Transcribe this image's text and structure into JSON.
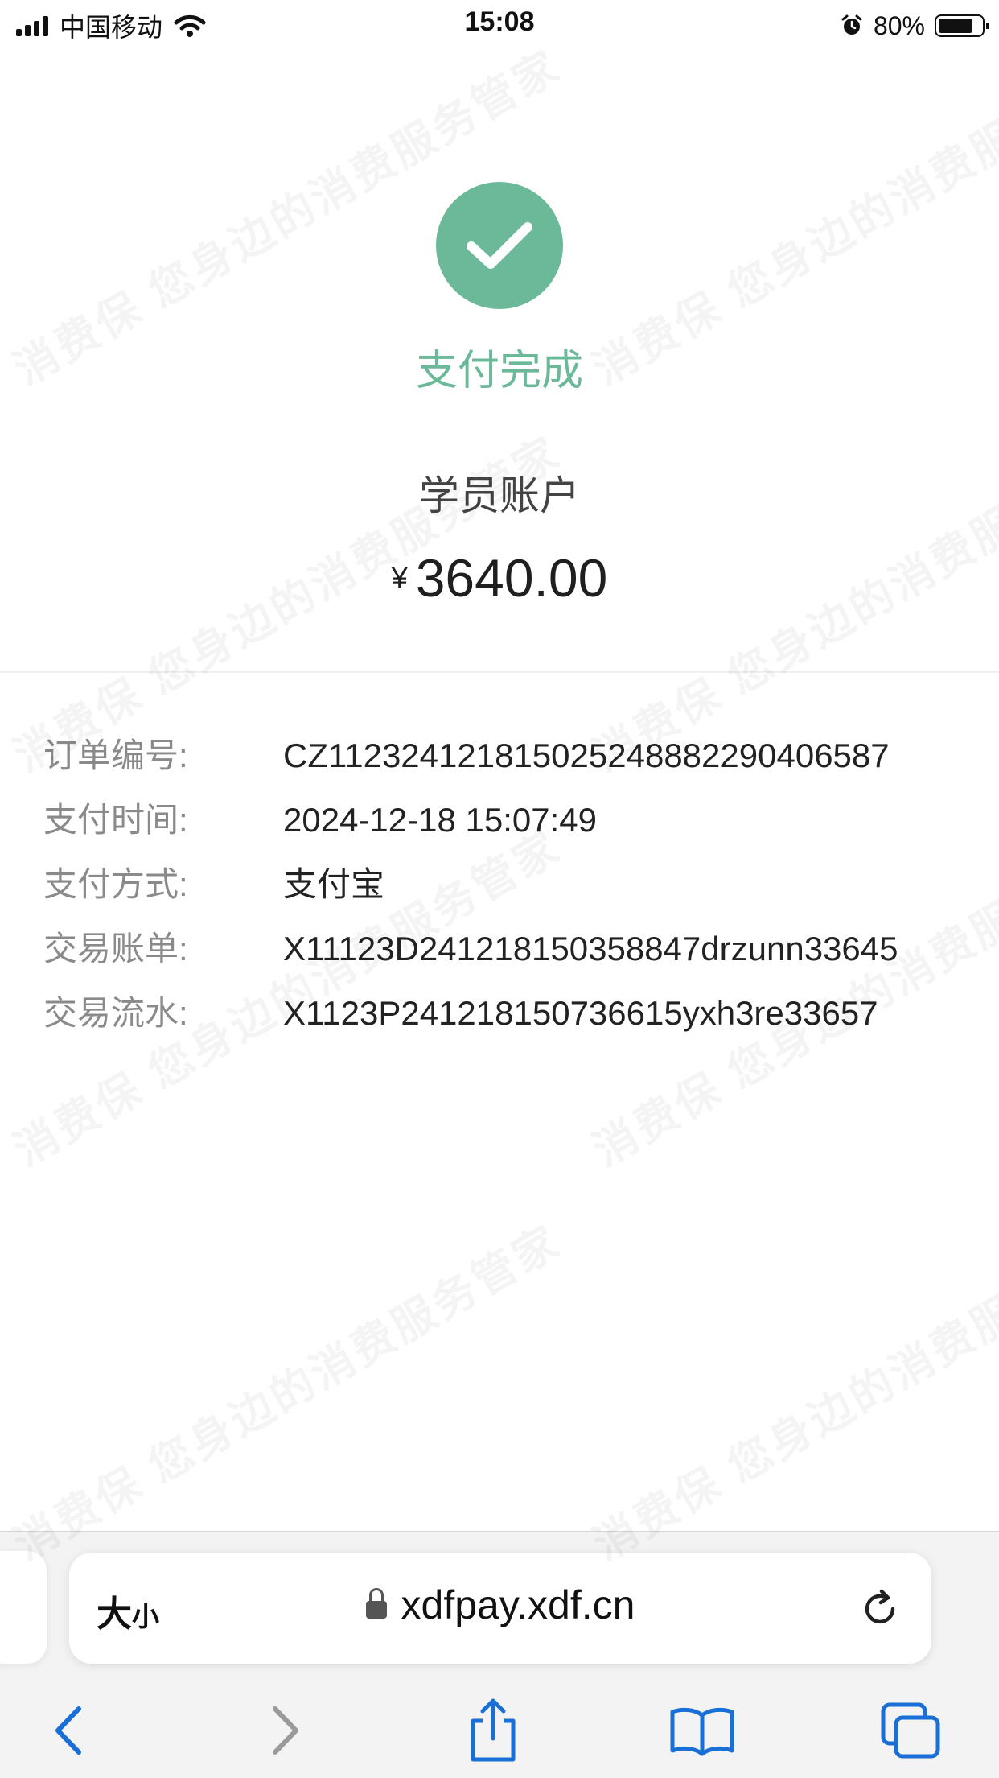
{
  "status_bar": {
    "carrier": "中国移动",
    "time": "15:08",
    "battery_percent": "80%",
    "battery_level": 0.8,
    "icons": [
      "signal-icon",
      "wifi-icon",
      "alarm-icon",
      "battery-icon"
    ]
  },
  "watermark": {
    "text": "消费保 您身边的消费服务管家"
  },
  "payment": {
    "status": "支付完成",
    "account": "学员账户",
    "currency": "¥",
    "amount": "3640.00",
    "accent_color": "#6cb99a"
  },
  "details": [
    {
      "label": "订单编号:",
      "value": "CZ112324121815025248882290406587"
    },
    {
      "label": "支付时间:",
      "value": "2024-12-18 15:07:49"
    },
    {
      "label": "支付方式:",
      "value": "支付宝"
    },
    {
      "label": "交易账单:",
      "value": "X11123D241218150358847drzunn33645"
    },
    {
      "label": "交易流水:",
      "value": "X1123P241218150736615yxh3re33657"
    }
  ],
  "browser": {
    "text_size_big": "大",
    "text_size_small": "小",
    "url": "xdfpay.xdf.cn",
    "accent_color": "#1a6fd6",
    "toolbar_icons": [
      "back-icon",
      "forward-icon",
      "share-icon",
      "bookmarks-icon",
      "tabs-icon"
    ]
  }
}
